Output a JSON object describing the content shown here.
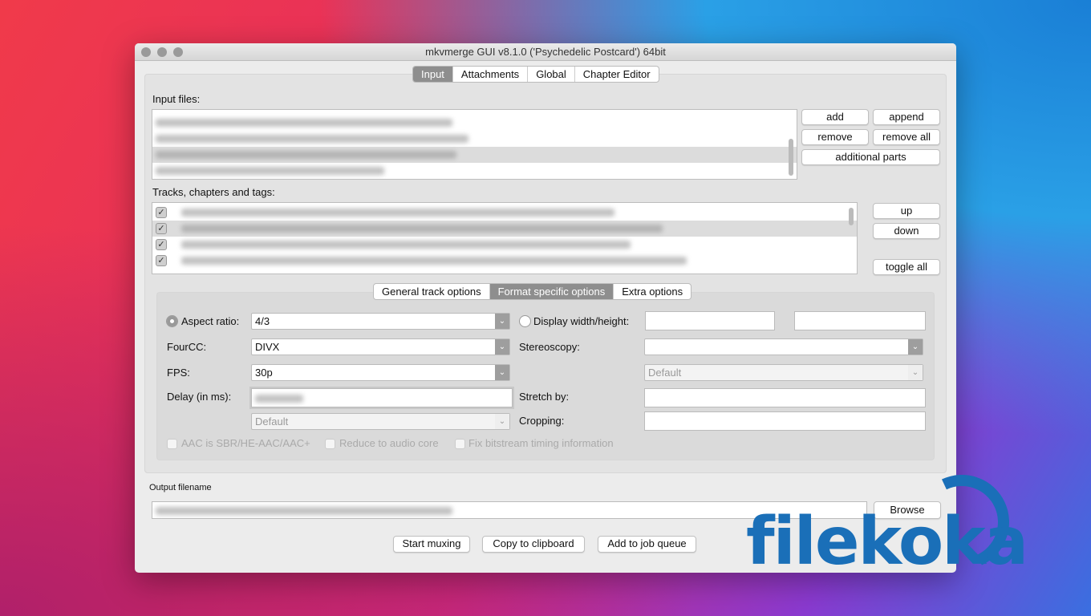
{
  "window": {
    "title": "mkvmerge GUI v8.1.0 ('Psychedelic Postcard') 64bit"
  },
  "tabs": [
    {
      "label": "Input",
      "active": true
    },
    {
      "label": "Attachments"
    },
    {
      "label": "Global"
    },
    {
      "label": "Chapter Editor"
    }
  ],
  "input_files": {
    "label": "Input files:",
    "buttons": {
      "add": "add",
      "append": "append",
      "remove": "remove",
      "remove_all": "remove all",
      "additional_parts": "additional parts"
    }
  },
  "tracks": {
    "label": "Tracks, chapters and tags:",
    "checked": [
      true,
      true,
      true,
      true
    ],
    "buttons": {
      "up": "up",
      "down": "down",
      "toggle_all": "toggle all"
    }
  },
  "subtabs": [
    {
      "label": "General track options"
    },
    {
      "label": "Format specific options",
      "active": true
    },
    {
      "label": "Extra options"
    }
  ],
  "format": {
    "aspect_ratio_label": "Aspect ratio:",
    "aspect_ratio_value": "4/3",
    "display_wh_label": "Display width/height:",
    "fourcc_label": "FourCC:",
    "fourcc_value": "DIVX",
    "stereoscopy_label": "Stereoscopy:",
    "fps_label": "FPS:",
    "fps_value": "30p",
    "default_right": "Default",
    "delay_label": "Delay (in ms):",
    "default_left": "Default",
    "stretch_label": "Stretch by:",
    "cropping_label": "Cropping:",
    "aac_label": "AAC is SBR/HE-AAC/AAC+",
    "reduce_label": "Reduce to audio core",
    "fix_label": "Fix bitstream timing information"
  },
  "output": {
    "label": "Output filename",
    "browse": "Browse"
  },
  "actions": {
    "start": "Start muxing",
    "copy": "Copy to clipboard",
    "queue": "Add to job queue"
  },
  "watermark": {
    "text": "filekoka",
    "color": "#1a6fb8"
  }
}
